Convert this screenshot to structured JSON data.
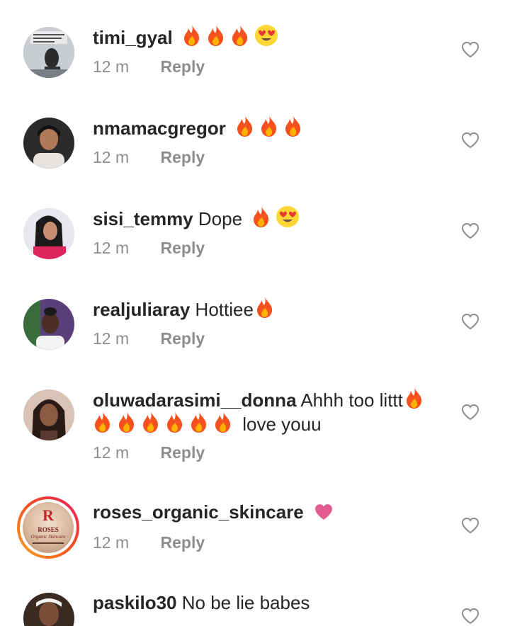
{
  "comments": [
    {
      "username": "timi_gyal",
      "text": "",
      "emojis": [
        "fire-emoji",
        "fire-emoji",
        "fire-emoji",
        "heart-eyes-emoji"
      ],
      "time": "12 m",
      "reply": "Reply"
    },
    {
      "username": "nmamacgregor",
      "text": "",
      "emojis": [
        "fire-emoji",
        "fire-emoji",
        "fire-emoji"
      ],
      "time": "12 m",
      "reply": "Reply"
    },
    {
      "username": "sisi_temmy",
      "text": "Dope",
      "emojis": [
        "fire-emoji",
        "heart-eyes-emoji"
      ],
      "time": "12 m",
      "reply": "Reply"
    },
    {
      "username": "realjuliaray",
      "text": "Hottiee",
      "emojis": [
        "fire-emoji"
      ],
      "time": "12 m",
      "reply": "Reply"
    },
    {
      "username": "oluwadarasimi__donna",
      "text": "Ahhh too littt",
      "text2": "love youu",
      "emojis": [
        "fire-emoji",
        "fire-emoji",
        "fire-emoji",
        "fire-emoji",
        "fire-emoji",
        "fire-emoji",
        "fire-emoji"
      ],
      "time": "12 m",
      "reply": "Reply"
    },
    {
      "username": "roses_organic_skincare",
      "text": "",
      "emojis": [
        "pink-heart-emoji"
      ],
      "time": "12 m",
      "reply": "Reply",
      "avatar_logo": {
        "letter": "R",
        "line1": "ROSES",
        "line2": "Organic Skincare"
      }
    },
    {
      "username": "paskilo30",
      "text": "No be lie babes",
      "emojis": [],
      "time": "",
      "reply": ""
    }
  ],
  "colors": {
    "text": "#262626",
    "meta": "#8e8e8e",
    "fire": "#f4511e",
    "pink_heart": "#e25d8f",
    "like_outline": "#8e8e8e"
  }
}
